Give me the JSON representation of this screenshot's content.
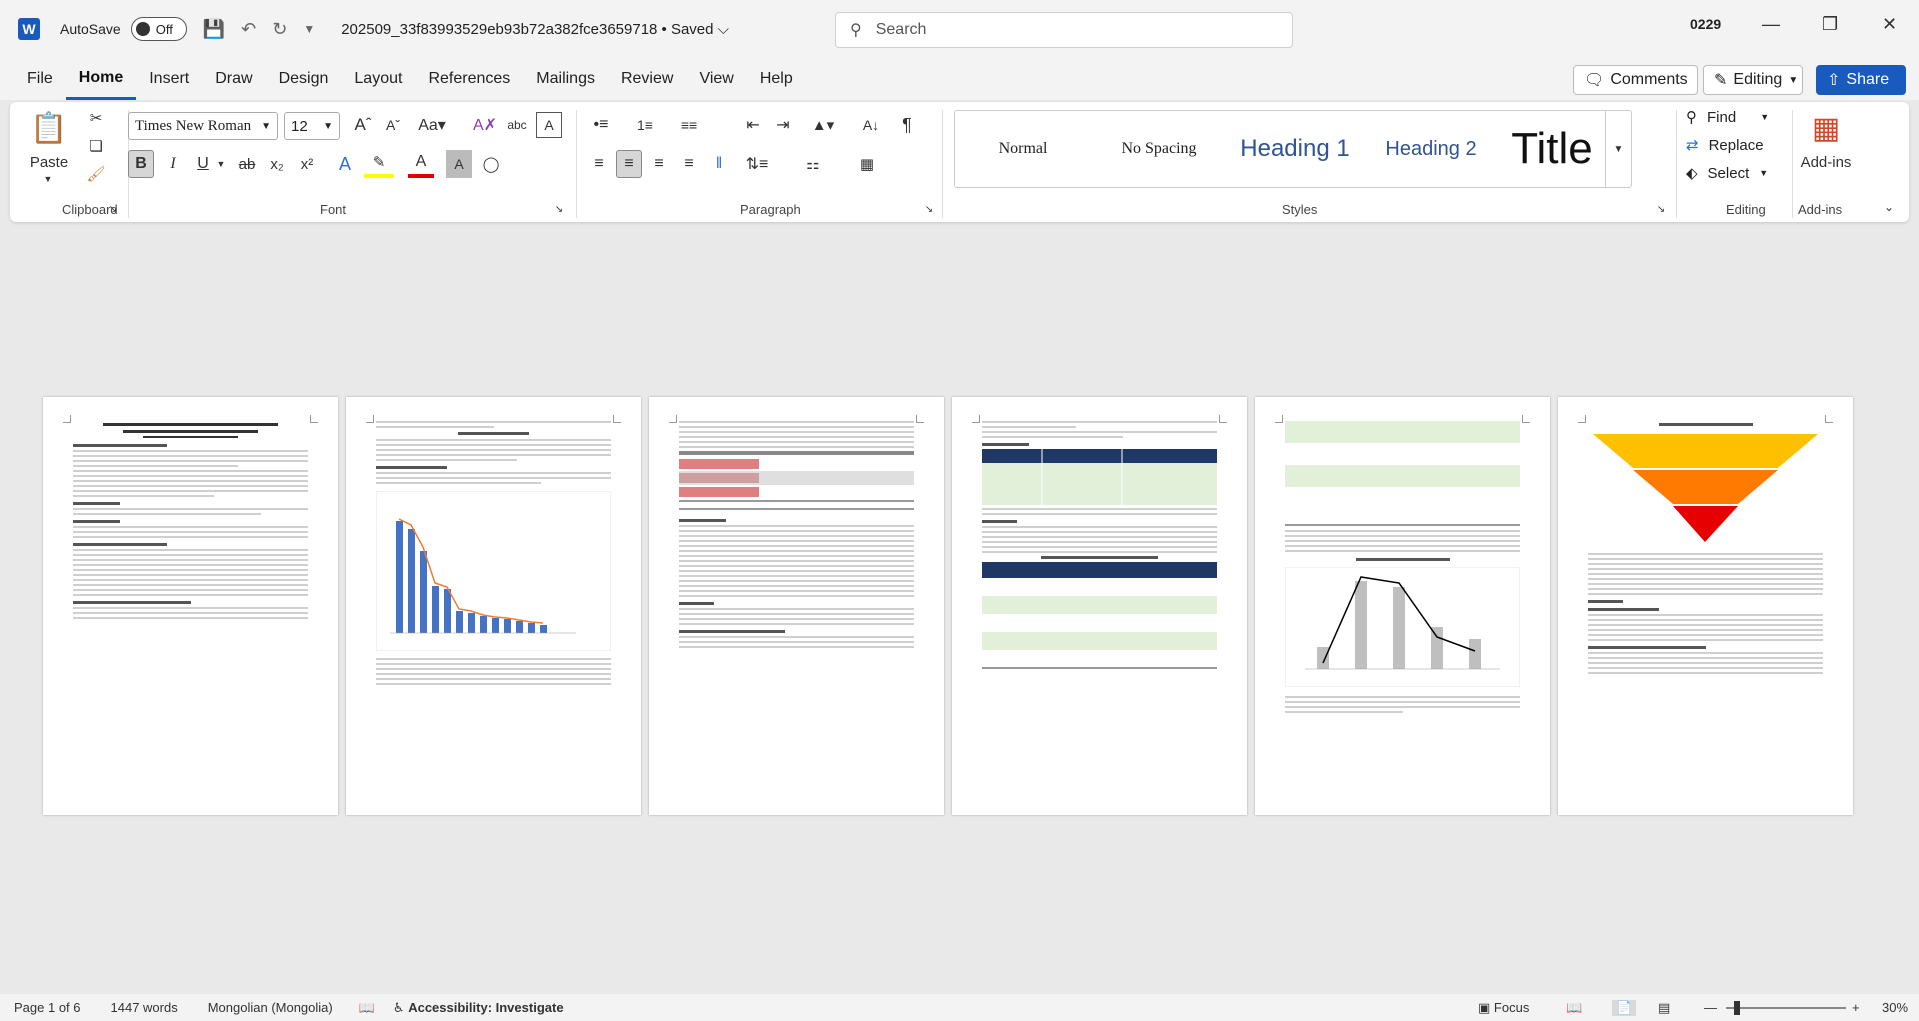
{
  "titlebar": {
    "logo": "W",
    "autosave_label": "AutoSave",
    "autosave_state": "Off",
    "doc_title": "202509_33f83993529eb93b72a382fce3659718 • Saved",
    "search_placeholder": "Search",
    "user": "0229"
  },
  "menu": {
    "items": [
      "File",
      "Home",
      "Insert",
      "Draw",
      "Design",
      "Layout",
      "References",
      "Mailings",
      "Review",
      "View",
      "Help"
    ],
    "comments": "Comments",
    "editing": "Editing",
    "share": "Share"
  },
  "ribbon": {
    "clipboard": {
      "label": "Clipboard",
      "paste": "Paste"
    },
    "font": {
      "label": "Font",
      "family": "Times New Roman",
      "size": "12"
    },
    "paragraph": {
      "label": "Paragraph"
    },
    "styles": {
      "label": "Styles",
      "items": [
        "Normal",
        "No Spacing",
        "Heading 1",
        "Heading 2",
        "Title"
      ]
    },
    "editing": {
      "label": "Editing",
      "find": "Find",
      "replace": "Replace",
      "select": "Select"
    },
    "addins": {
      "label": "Add-ins",
      "button": "Add-ins"
    }
  },
  "status": {
    "page": "Page 1 of 6",
    "words": "1447 words",
    "language": "Mongolian (Mongolia)",
    "accessibility": "Accessibility: Investigate",
    "focus": "Focus",
    "zoom": "30%"
  },
  "colors": {
    "accent": "#185abd",
    "triangle_top": "#ffc000",
    "triangle_mid": "#ff7a00",
    "triangle_bottom": "#e60000",
    "table_header": "#1f3864",
    "table_alt": "#e2efd9"
  }
}
